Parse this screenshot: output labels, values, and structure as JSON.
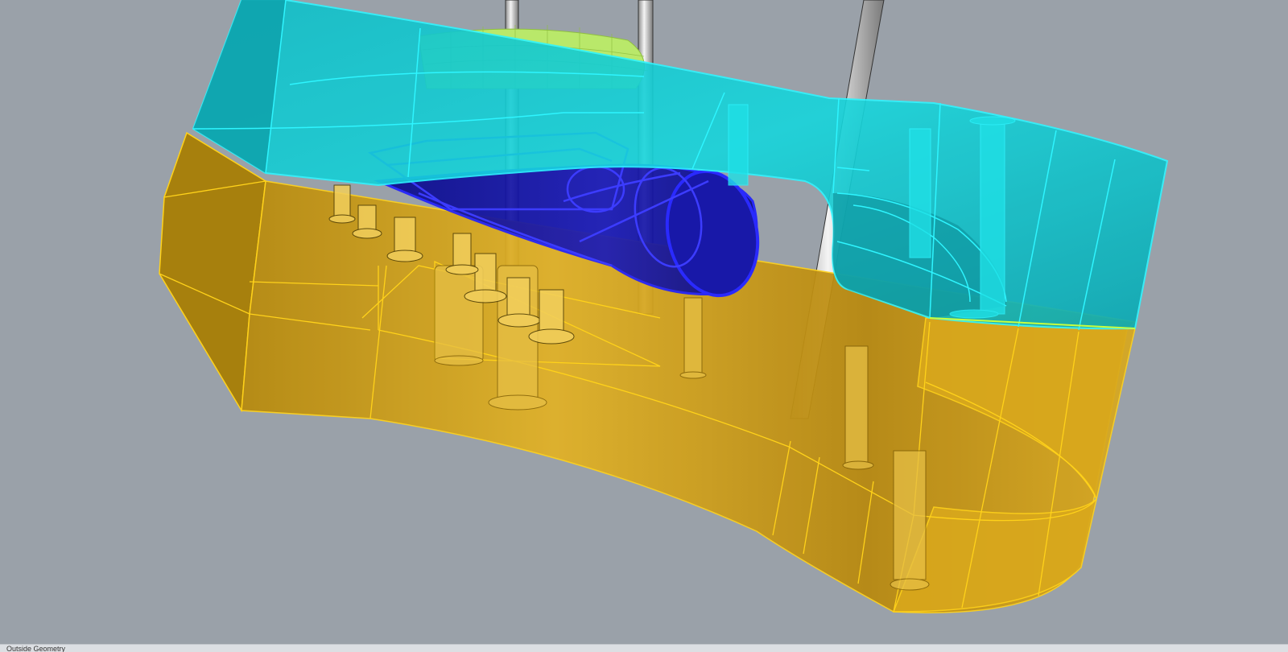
{
  "app": {
    "title": ""
  },
  "viewport": {
    "background_color": "#9aa1a9",
    "render_mode": "ghosted-shaded"
  },
  "status_bar": {
    "text": "Outside Geometry"
  },
  "colors": {
    "upper_mold_half": "#11cfd6",
    "upper_mold_edges": "#2ef5ff",
    "lower_mold_half": "#d9a514",
    "lower_mold_edges": "#ffd21a",
    "part_cavity": "#1414d6",
    "top_cap": "#b9e86a",
    "ejector_pins": "#dcdcdc"
  },
  "objects": [
    {
      "name": "upper-mold-half",
      "color_key": "upper_mold_half"
    },
    {
      "name": "lower-mold-half",
      "color_key": "lower_mold_half"
    },
    {
      "name": "part-cavity",
      "color_key": "part_cavity"
    },
    {
      "name": "top-cap-dome",
      "color_key": "top_cap"
    },
    {
      "name": "ejector-pins",
      "color_key": "ejector_pins"
    }
  ]
}
